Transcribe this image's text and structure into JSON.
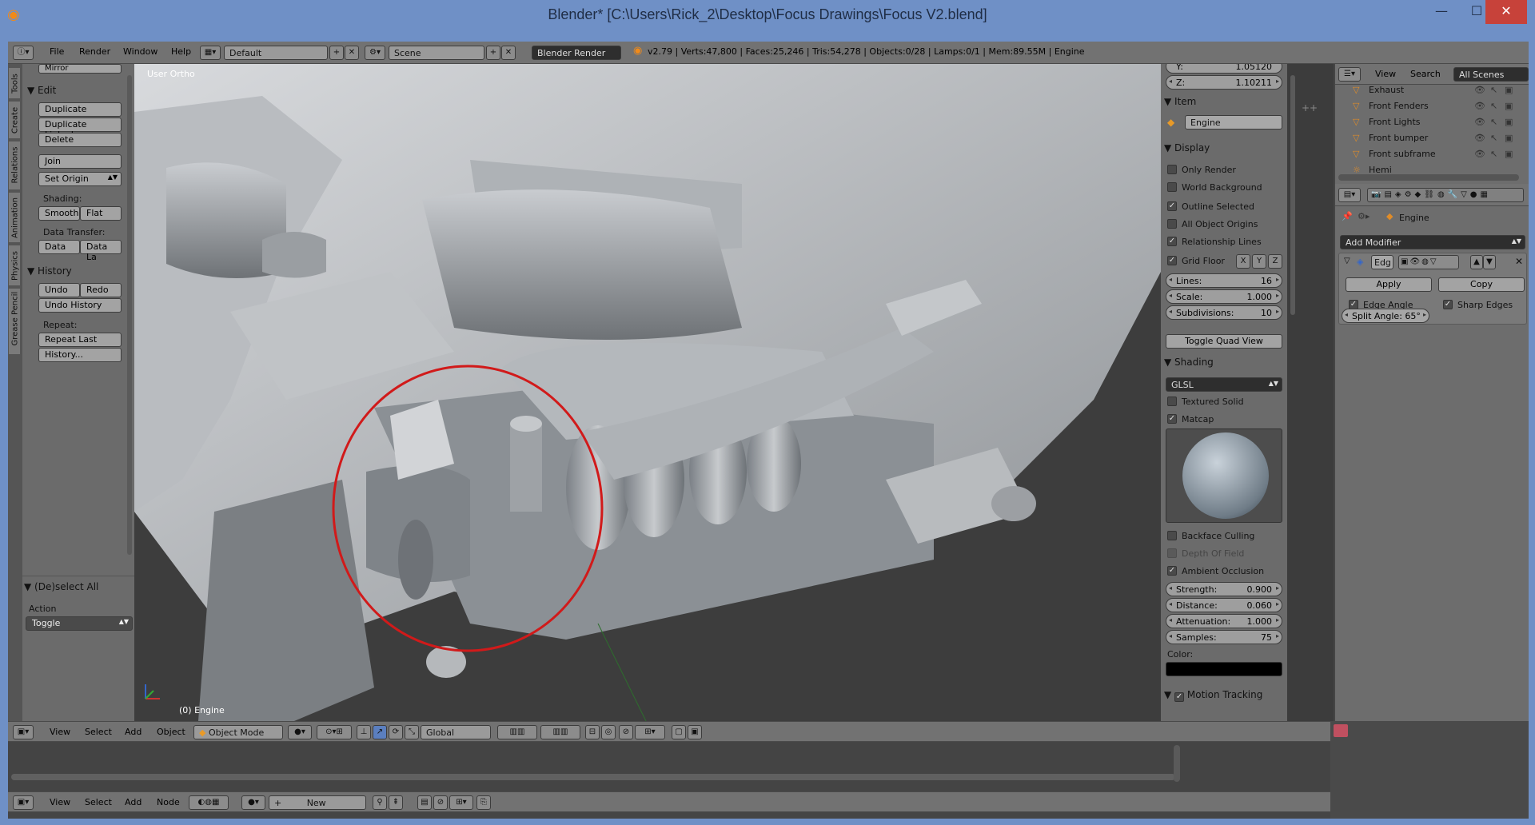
{
  "window": {
    "title": "Blender* [C:\\Users\\Rick_2\\Desktop\\Focus Drawings\\Focus V2.blend]",
    "min_icon": "minimize-icon",
    "max_icon": "maximize-icon",
    "close_icon": "close-icon"
  },
  "topbar": {
    "menus": [
      "File",
      "Render",
      "Window",
      "Help"
    ],
    "screen_layout": "Default",
    "scene": "Scene",
    "engine": "Blender Render",
    "stats": "v2.79 | Verts:47,800 | Faces:25,246 | Tris:54,278 | Objects:0/28 | Lamps:0/1 | Mem:89.55M | Engine"
  },
  "tool_tabs": [
    "Tools",
    "Create",
    "Relations",
    "Animation",
    "Physics",
    "Grease Pencil"
  ],
  "tools": {
    "mirror": "Mirror",
    "edit_title": "Edit",
    "duplicate": "Duplicate",
    "duplicate_linked": "Duplicate Linked",
    "delete": "Delete",
    "join": "Join",
    "set_origin": "Set Origin",
    "shading_label": "Shading:",
    "smooth": "Smooth",
    "flat": "Flat",
    "data_transfer_label": "Data Transfer:",
    "data": "Data",
    "data_la": "Data La",
    "history_title": "History",
    "undo": "Undo",
    "redo": "Redo",
    "undo_history": "Undo History",
    "repeat_label": "Repeat:",
    "repeat_last": "Repeat Last",
    "history_dots": "History...",
    "operator_title": "(De)select All",
    "action_label": "Action",
    "action_value": "Toggle"
  },
  "viewport": {
    "view_label": "User Ortho",
    "object_label": "(0) Engine",
    "annotation_color": "#d11a1a"
  },
  "properties_n": {
    "y_row": "Y:",
    "y_value": "1.05120",
    "z_label": "Z:",
    "z_value": "1.10211",
    "item_title": "Item",
    "object_name": "Engine",
    "display_title": "Display",
    "only_render": "Only Render",
    "world_background": "World Background",
    "outline_selected": "Outline Selected",
    "all_object_origins": "All Object Origins",
    "relationship_lines": "Relationship Lines",
    "grid_floor": "Grid Floor",
    "axis_x": "X",
    "axis_y": "Y",
    "axis_z": "Z",
    "lines_label": "Lines:",
    "lines_value": "16",
    "scale_label": "Scale:",
    "scale_value": "1.000",
    "subdiv_label": "Subdivisions:",
    "subdiv_value": "10",
    "toggle_quad": "Toggle Quad View",
    "shading_title": "Shading",
    "shading_mode": "GLSL",
    "textured_solid": "Textured Solid",
    "matcap": "Matcap",
    "backface_culling": "Backface Culling",
    "depth_of_field": "Depth Of Field",
    "ambient_occlusion": "Ambient Occlusion",
    "strength_label": "Strength:",
    "strength_value": "0.900",
    "distance_label": "Distance:",
    "distance_value": "0.060",
    "attenuation_label": "Attenuation:",
    "attenuation_value": "1.000",
    "samples_label": "Samples:",
    "samples_value": "75",
    "color_label": "Color:",
    "color_value": "#000000",
    "motion_tracking": "Motion Tracking"
  },
  "outliner": {
    "menus": [
      "View",
      "Search"
    ],
    "filter": "All Scenes",
    "items": [
      "Exhaust",
      "Front Fenders",
      "Front Lights",
      "Front bumper",
      "Front subframe",
      "Hemi"
    ]
  },
  "modifiers": {
    "object": "Engine",
    "add_modifier": "Add Modifier",
    "mod_name": "Edg",
    "apply": "Apply",
    "copy": "Copy",
    "edge_angle": "Edge Angle",
    "sharp_edges": "Sharp Edges",
    "split_angle": "Split Angle: 65°"
  },
  "view3d_header": {
    "menus": [
      "View",
      "Select",
      "Add",
      "Object"
    ],
    "mode": "Object Mode",
    "orientation": "Global"
  },
  "node_header": {
    "menus": [
      "View",
      "Select",
      "Add",
      "Node"
    ],
    "new_label": "New"
  }
}
